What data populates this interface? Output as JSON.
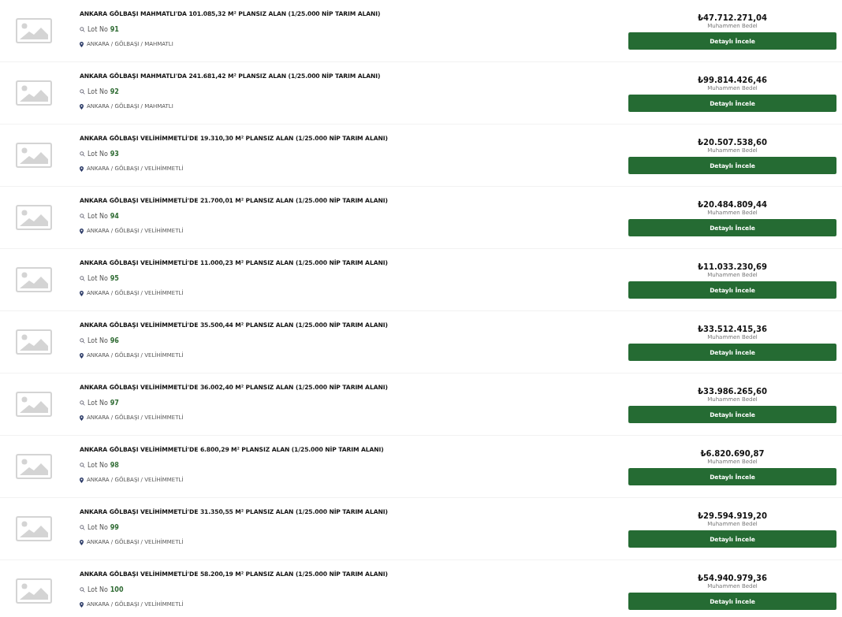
{
  "listings": [
    {
      "title": "ANKARA GÖLBAŞI MAHMATLI'DA 101.085,32 M² PLANSIZ ALAN (1/25.000 NİP TARIM ALANI)",
      "lot_label": "Lot No",
      "lot": "91",
      "location": "ANKARA / GÖLBAŞI / MAHMATLI",
      "price": "₺47.712.271,04",
      "price_label": "Muhammen Bedel",
      "button": "Detaylı İncele"
    },
    {
      "title": "ANKARA GÖLBAŞI MAHMATLI'DA 241.681,42 M² PLANSIZ ALAN (1/25.000 NİP TARIM ALANI)",
      "lot_label": "Lot No",
      "lot": "92",
      "location": "ANKARA / GÖLBAŞI / MAHMATLI",
      "price": "₺99.814.426,46",
      "price_label": "Muhammen Bedel",
      "button": "Detaylı İncele"
    },
    {
      "title": "ANKARA GÖLBAŞI VELİHİMMETLİ'DE 19.310,30 M² PLANSIZ ALAN (1/25.000 NİP TARIM ALANI)",
      "lot_label": "Lot No",
      "lot": "93",
      "location": "ANKARA / GÖLBAŞI / VELİHİMMETLİ",
      "price": "₺20.507.538,60",
      "price_label": "Muhammen Bedel",
      "button": "Detaylı İncele"
    },
    {
      "title": "ANKARA GÖLBAŞI VELİHİMMETLİ'DE 21.700,01 M² PLANSIZ ALAN (1/25.000 NİP TARIM ALANI)",
      "lot_label": "Lot No",
      "lot": "94",
      "location": "ANKARA / GÖLBAŞI / VELİHİMMETLİ",
      "price": "₺20.484.809,44",
      "price_label": "Muhammen Bedel",
      "button": "Detaylı İncele"
    },
    {
      "title": "ANKARA GÖLBAŞI VELİHİMMETLİ'DE 11.000,23 M² PLANSIZ ALAN (1/25.000 NİP TARIM ALANI)",
      "lot_label": "Lot No",
      "lot": "95",
      "location": "ANKARA / GÖLBAŞI / VELİHİMMETLİ",
      "price": "₺11.033.230,69",
      "price_label": "Muhammen Bedel",
      "button": "Detaylı İncele"
    },
    {
      "title": "ANKARA GÖLBAŞI VELİHİMMETLİ'DE 35.500,44 M² PLANSIZ ALAN (1/25.000 NİP TARIM ALANI)",
      "lot_label": "Lot No",
      "lot": "96",
      "location": "ANKARA / GÖLBAŞI / VELİHİMMETLİ",
      "price": "₺33.512.415,36",
      "price_label": "Muhammen Bedel",
      "button": "Detaylı İncele"
    },
    {
      "title": "ANKARA GÖLBAŞI VELİHİMMETLİ'DE 36.002,40 M² PLANSIZ ALAN (1/25.000 NİP TARIM ALANI)",
      "lot_label": "Lot No",
      "lot": "97",
      "location": "ANKARA / GÖLBAŞI / VELİHİMMETLİ",
      "price": "₺33.986.265,60",
      "price_label": "Muhammen Bedel",
      "button": "Detaylı İncele"
    },
    {
      "title": "ANKARA GÖLBAŞI VELİHİMMETLİ'DE 6.800,29 M² PLANSIZ ALAN (1/25.000 NİP TARIM ALANI)",
      "lot_label": "Lot No",
      "lot": "98",
      "location": "ANKARA / GÖLBAŞI / VELİHİMMETLİ",
      "price": "₺6.820.690,87",
      "price_label": "Muhammen Bedel",
      "button": "Detaylı İncele"
    },
    {
      "title": "ANKARA GÖLBAŞI VELİHİMMETLİ'DE 31.350,55 M² PLANSIZ ALAN (1/25.000 NİP TARIM ALANI)",
      "lot_label": "Lot No",
      "lot": "99",
      "location": "ANKARA / GÖLBAŞI / VELİHİMMETLİ",
      "price": "₺29.594.919,20",
      "price_label": "Muhammen Bedel",
      "button": "Detaylı İncele"
    },
    {
      "title": "ANKARA GÖLBAŞI VELİHİMMETLİ'DE 58.200,19 M² PLANSIZ ALAN (1/25.000 NİP TARIM ALANI)",
      "lot_label": "Lot No",
      "lot": "100",
      "location": "ANKARA / GÖLBAŞI / VELİHİMMETLİ",
      "price": "₺54.940.979,36",
      "price_label": "Muhammen Bedel",
      "button": "Detaylı İncele"
    }
  ]
}
